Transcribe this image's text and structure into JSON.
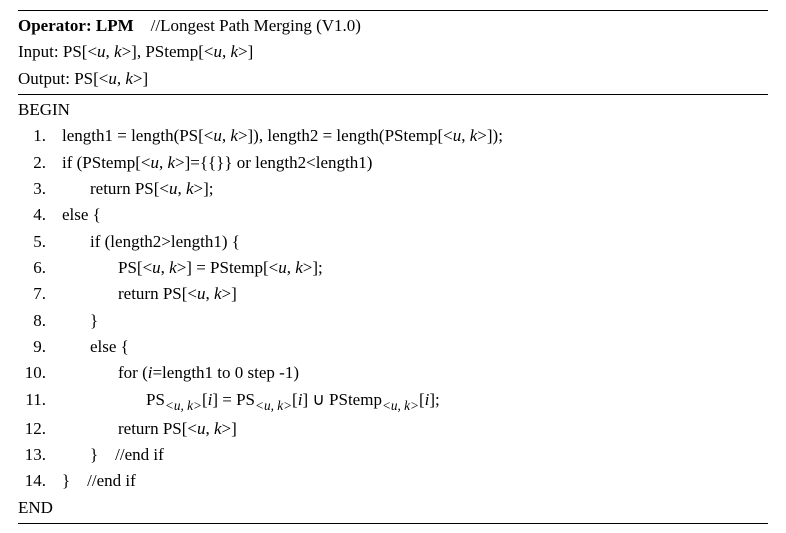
{
  "header": {
    "operator_label": "Operator: LPM",
    "operator_comment": "//Longest Path Merging (V1.0)",
    "input_label": "Input: ",
    "input_args": "PS[<u, k>], PStemp[<u, k>]",
    "output_label": "Output: ",
    "output_args": "PS[<u, k>]"
  },
  "code": {
    "begin": "BEGIN",
    "end": "END",
    "lines": [
      {
        "n": "1.",
        "indent": 1,
        "tokens": [
          {
            "t": "length1 = length(PS[<"
          },
          {
            "t": "u",
            "i": true
          },
          {
            "t": ", "
          },
          {
            "t": "k",
            "i": true
          },
          {
            "t": ">]), length2 = length(PStemp[<"
          },
          {
            "t": "u",
            "i": true
          },
          {
            "t": ", "
          },
          {
            "t": "k",
            "i": true
          },
          {
            "t": ">]);"
          }
        ]
      },
      {
        "n": "2.",
        "indent": 1,
        "tokens": [
          {
            "t": "if (PStemp[<"
          },
          {
            "t": "u",
            "i": true
          },
          {
            "t": ", "
          },
          {
            "t": "k",
            "i": true
          },
          {
            "t": ">]={{}} or length2<length1)"
          }
        ]
      },
      {
        "n": "3.",
        "indent": 2,
        "tokens": [
          {
            "t": "return PS[<"
          },
          {
            "t": "u",
            "i": true
          },
          {
            "t": ", "
          },
          {
            "t": "k",
            "i": true
          },
          {
            "t": ">];"
          }
        ]
      },
      {
        "n": "4.",
        "indent": 1,
        "tokens": [
          {
            "t": "else {"
          }
        ]
      },
      {
        "n": "5.",
        "indent": 2,
        "tokens": [
          {
            "t": "if (length2>length1) {"
          }
        ]
      },
      {
        "n": "6.",
        "indent": 3,
        "tokens": [
          {
            "t": "PS[<"
          },
          {
            "t": "u",
            "i": true
          },
          {
            "t": ", "
          },
          {
            "t": "k",
            "i": true
          },
          {
            "t": ">] = PStemp[<"
          },
          {
            "t": "u",
            "i": true
          },
          {
            "t": ", "
          },
          {
            "t": "k",
            "i": true
          },
          {
            "t": ">];"
          }
        ]
      },
      {
        "n": "7.",
        "indent": 3,
        "tokens": [
          {
            "t": "return PS[<"
          },
          {
            "t": "u",
            "i": true
          },
          {
            "t": ", "
          },
          {
            "t": "k",
            "i": true
          },
          {
            "t": ">]"
          }
        ]
      },
      {
        "n": "8.",
        "indent": 2,
        "tokens": [
          {
            "t": "}"
          }
        ]
      },
      {
        "n": "9.",
        "indent": 2,
        "tokens": [
          {
            "t": "else {"
          }
        ]
      },
      {
        "n": "10.",
        "indent": 3,
        "tokens": [
          {
            "t": "for ("
          },
          {
            "t": "i",
            "i": true
          },
          {
            "t": "=length1 to 0 step -1)"
          }
        ]
      },
      {
        "n": "11.",
        "indent": 4,
        "tokens": [
          {
            "t": "PS"
          },
          {
            "t": "<u, k>",
            "sub": true,
            "i": true
          },
          {
            "t": "["
          },
          {
            "t": "i",
            "i": true
          },
          {
            "t": "] = PS"
          },
          {
            "t": "<u, k>",
            "sub": true,
            "i": true
          },
          {
            "t": "["
          },
          {
            "t": "i",
            "i": true
          },
          {
            "t": "] ∪ PStemp"
          },
          {
            "t": "<u, k>",
            "sub": true,
            "i": true
          },
          {
            "t": "["
          },
          {
            "t": "i",
            "i": true
          },
          {
            "t": "];"
          }
        ]
      },
      {
        "n": "12.",
        "indent": 3,
        "tokens": [
          {
            "t": "return PS[<"
          },
          {
            "t": "u",
            "i": true
          },
          {
            "t": ", "
          },
          {
            "t": "k",
            "i": true
          },
          {
            "t": ">]"
          }
        ]
      },
      {
        "n": "13.",
        "indent": 2,
        "tokens": [
          {
            "t": "}    //end if"
          }
        ]
      },
      {
        "n": "14.",
        "indent": 1,
        "tokens": [
          {
            "t": "}    //end if"
          }
        ]
      }
    ]
  }
}
